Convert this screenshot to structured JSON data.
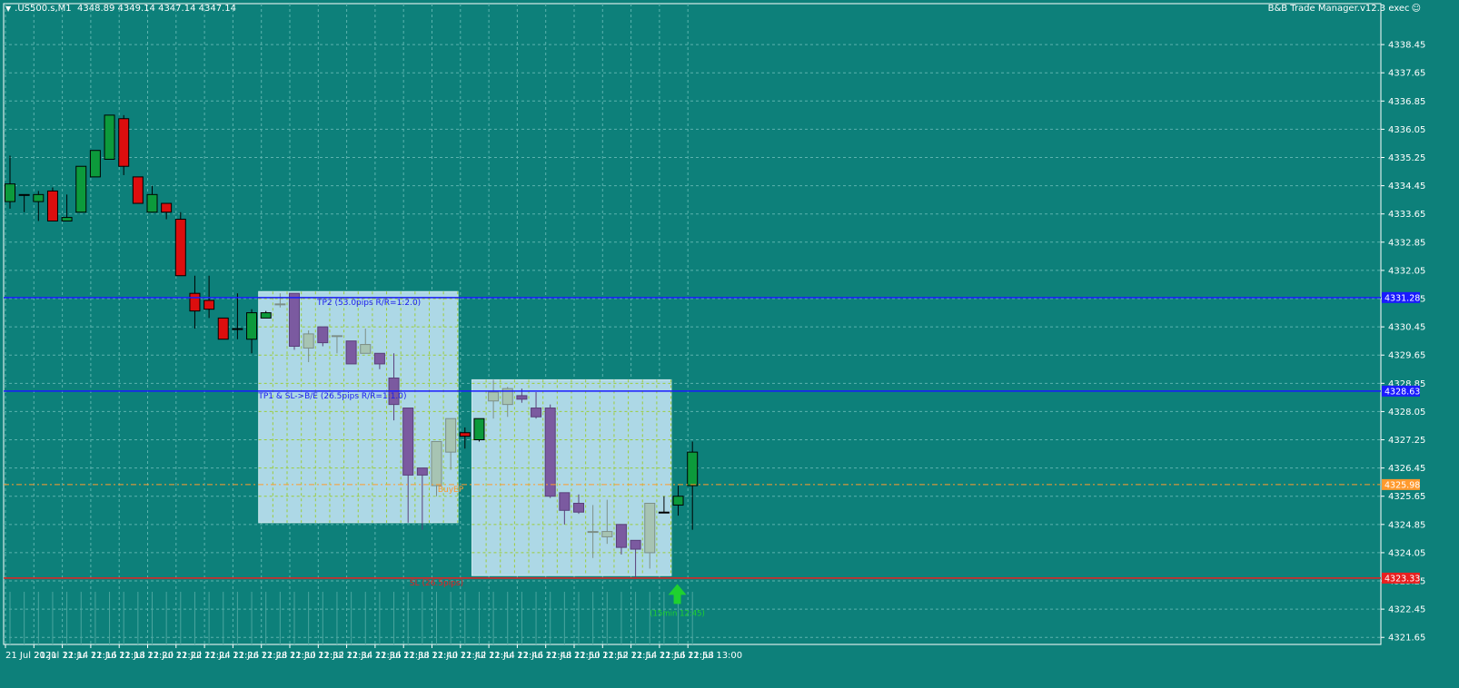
{
  "header": {
    "symbol": ".US500.s,M1",
    "ohlc": "4348.89 4349.14 4347.14 4347.14",
    "expert": "B&B Trade Manager.v12.3 exec",
    "smiley": "☺",
    "menu_arrow": "▼"
  },
  "colors": {
    "background": "#0d807a",
    "grid": "#5cb3ae",
    "bull": "#0c9a3b",
    "bear": "#dc0e0e",
    "zone_bull": "#a7c4b3",
    "zone_bear": "#7b5aa0",
    "zone_fill": "#add8e6",
    "tp_line": "#1a1aff",
    "sl_line": "#e82020",
    "entry_line": "#ff9a2e",
    "axis_bg": "#0d807a"
  },
  "chart_data": {
    "type": "candlestick",
    "ylim": [
      4321.45,
      4339.25
    ],
    "price_ticks": [
      "4338.45",
      "4337.65",
      "4336.85",
      "4336.05",
      "4335.25",
      "4334.45",
      "4333.65",
      "4332.85",
      "4332.05",
      "4331.25",
      "4330.45",
      "4329.65",
      "4328.85",
      "4328.05",
      "4327.25",
      "4326.45",
      "4325.65",
      "4324.85",
      "4324.05",
      "4323.25",
      "4322.45",
      "4321.65"
    ],
    "time_ticks": [
      "21 Jul 2021",
      "21 Jul 12:14",
      "21 Jul 12:16",
      "21 Jul 12:18",
      "21 Jul 12:20",
      "21 Jul 12:22",
      "21 Jul 12:24",
      "21 Jul 12:26",
      "21 Jul 12:28",
      "21 Jul 12:30",
      "21 Jul 12:32",
      "21 Jul 12:34",
      "21 Jul 12:36",
      "21 Jul 12:38",
      "21 Jul 12:40",
      "21 Jul 12:42",
      "21 Jul 12:44",
      "21 Jul 12:46",
      "21 Jul 12:48",
      "21 Jul 12:50",
      "21 Jul 12:52",
      "21 Jul 12:54",
      "21 Jul 12:56",
      "21 Jul 12:58",
      "21 Jul 13:00"
    ],
    "candles": [
      {
        "o": 4334.0,
        "h": 4335.3,
        "l": 4333.8,
        "c": 4334.5,
        "s": "n"
      },
      {
        "o": 4334.2,
        "h": 4334.2,
        "l": 4333.7,
        "c": 4334.2,
        "s": "n"
      },
      {
        "o": 4334.0,
        "h": 4334.3,
        "l": 4333.45,
        "c": 4334.2,
        "s": "n"
      },
      {
        "o": 4334.3,
        "h": 4334.4,
        "l": 4333.45,
        "c": 4333.45,
        "s": "n"
      },
      {
        "o": 4333.45,
        "h": 4334.2,
        "l": 4333.45,
        "c": 4333.55,
        "s": "n"
      },
      {
        "o": 4333.7,
        "h": 4335.0,
        "l": 4333.7,
        "c": 4335.0,
        "s": "n"
      },
      {
        "o": 4334.7,
        "h": 4335.45,
        "l": 4334.7,
        "c": 4335.45,
        "s": "n"
      },
      {
        "o": 4335.2,
        "h": 4336.45,
        "l": 4335.2,
        "c": 4336.45,
        "s": "n"
      },
      {
        "o": 4336.35,
        "h": 4336.45,
        "l": 4334.75,
        "c": 4335.0,
        "s": "n"
      },
      {
        "o": 4334.7,
        "h": 4334.7,
        "l": 4333.95,
        "c": 4333.95,
        "s": "n"
      },
      {
        "o": 4333.7,
        "h": 4334.45,
        "l": 4333.7,
        "c": 4334.2,
        "s": "n"
      },
      {
        "o": 4333.95,
        "h": 4333.95,
        "l": 4333.5,
        "c": 4333.7,
        "s": "n"
      },
      {
        "o": 4333.5,
        "h": 4333.7,
        "l": 4331.9,
        "c": 4331.9,
        "s": "n"
      },
      {
        "o": 4331.4,
        "h": 4331.9,
        "l": 4330.4,
        "c": 4330.9,
        "s": "n"
      },
      {
        "o": 4331.2,
        "h": 4331.9,
        "l": 4330.7,
        "c": 4330.95,
        "s": "n"
      },
      {
        "o": 4330.7,
        "h": 4330.7,
        "l": 4330.1,
        "c": 4330.1,
        "s": "n"
      },
      {
        "o": 4330.4,
        "h": 4331.4,
        "l": 4330.1,
        "c": 4330.4,
        "s": "n"
      },
      {
        "o": 4330.1,
        "h": 4330.95,
        "l": 4329.7,
        "c": 4330.85,
        "s": "n"
      },
      {
        "o": 4330.7,
        "h": 4330.9,
        "l": 4330.7,
        "c": 4330.85,
        "s": "n"
      },
      {
        "o": 4331.1,
        "h": 4331.4,
        "l": 4331.0,
        "c": 4331.1,
        "s": "z"
      },
      {
        "o": 4331.4,
        "h": 4331.4,
        "l": 4329.8,
        "c": 4329.9,
        "s": "z"
      },
      {
        "o": 4329.85,
        "h": 4330.35,
        "l": 4329.45,
        "c": 4330.25,
        "s": "z"
      },
      {
        "o": 4330.45,
        "h": 4330.45,
        "l": 4329.9,
        "c": 4330.0,
        "s": "z"
      },
      {
        "o": 4330.2,
        "h": 4330.2,
        "l": 4329.7,
        "c": 4330.2,
        "s": "z"
      },
      {
        "o": 4330.05,
        "h": 4330.05,
        "l": 4329.4,
        "c": 4329.4,
        "s": "z"
      },
      {
        "o": 4329.7,
        "h": 4330.4,
        "l": 4329.7,
        "c": 4329.95,
        "s": "z"
      },
      {
        "o": 4329.7,
        "h": 4329.7,
        "l": 4329.25,
        "c": 4329.4,
        "s": "z"
      },
      {
        "o": 4329.0,
        "h": 4329.7,
        "l": 4327.8,
        "c": 4328.25,
        "s": "z"
      },
      {
        "o": 4328.15,
        "h": 4328.15,
        "l": 4324.9,
        "c": 4326.25,
        "s": "z"
      },
      {
        "o": 4326.45,
        "h": 4326.45,
        "l": 4324.7,
        "c": 4326.25,
        "s": "z"
      },
      {
        "o": 4325.95,
        "h": 4327.2,
        "l": 4325.65,
        "c": 4327.2,
        "s": "z"
      },
      {
        "o": 4326.9,
        "h": 4327.85,
        "l": 4326.4,
        "c": 4327.85,
        "s": "z"
      },
      {
        "o": 4327.45,
        "h": 4327.6,
        "l": 4327.0,
        "c": 4327.35,
        "s": "n"
      },
      {
        "o": 4327.25,
        "h": 4327.85,
        "l": 4327.2,
        "c": 4327.85,
        "s": "n"
      },
      {
        "o": 4328.35,
        "h": 4328.95,
        "l": 4327.85,
        "c": 4328.6,
        "s": "z"
      },
      {
        "o": 4328.25,
        "h": 4328.75,
        "l": 4327.9,
        "c": 4328.7,
        "s": "z"
      },
      {
        "o": 4328.5,
        "h": 4328.7,
        "l": 4328.3,
        "c": 4328.4,
        "s": "z"
      },
      {
        "o": 4328.15,
        "h": 4328.6,
        "l": 4327.85,
        "c": 4327.9,
        "s": "z"
      },
      {
        "o": 4328.15,
        "h": 4328.25,
        "l": 4325.6,
        "c": 4325.65,
        "s": "z"
      },
      {
        "o": 4325.75,
        "h": 4325.75,
        "l": 4324.85,
        "c": 4325.25,
        "s": "z"
      },
      {
        "o": 4325.45,
        "h": 4325.7,
        "l": 4325.15,
        "c": 4325.2,
        "s": "z"
      },
      {
        "o": 4324.65,
        "h": 4325.4,
        "l": 4323.9,
        "c": 4324.65,
        "s": "z"
      },
      {
        "o": 4324.5,
        "h": 4325.55,
        "l": 4324.3,
        "c": 4324.65,
        "s": "z"
      },
      {
        "o": 4324.85,
        "h": 4324.85,
        "l": 4324.0,
        "c": 4324.2,
        "s": "z"
      },
      {
        "o": 4324.4,
        "h": 4324.4,
        "l": 4323.3,
        "c": 4324.15,
        "s": "z"
      },
      {
        "o": 4324.05,
        "h": 4325.45,
        "l": 4323.6,
        "c": 4325.45,
        "s": "z"
      },
      {
        "o": 4325.2,
        "h": 4325.65,
        "l": 4325.2,
        "c": 4325.2,
        "s": "n"
      },
      {
        "o": 4325.4,
        "h": 4325.95,
        "l": 4325.1,
        "c": 4325.65,
        "s": "n"
      },
      {
        "o": 4325.95,
        "h": 4327.2,
        "l": 4324.7,
        "c": 4326.9,
        "s": "n"
      }
    ],
    "levels": [
      {
        "price": 4331.28,
        "label": "TP2 (53.0pips R/R=1:2.0)",
        "tag": "4331.28",
        "kind": "tp",
        "label_bar": 28
      },
      {
        "price": 4328.63,
        "label": "TP1 & SL->B/E (26.5pips R/R=1:1.0)",
        "tag": "4328.63",
        "kind": "tp",
        "label_bar": 27
      },
      {
        "price": 4325.98,
        "label": "BuyEP",
        "tag": "4325.98",
        "kind": "entry",
        "label_bar": 31
      },
      {
        "price": 4323.33,
        "label": "SL (26.5pips)",
        "tag": "4323.33",
        "kind": "sl",
        "label_bar": 31
      }
    ],
    "zones": [
      {
        "start": 18,
        "end": 31,
        "top": 4331.45,
        "bottom": 4324.9
      },
      {
        "start": 33,
        "end": 46,
        "top": 4328.95,
        "bottom": 4323.4
      }
    ],
    "signal": {
      "label": "(15min 12:45)",
      "bar": 47,
      "price": 4322.65
    }
  }
}
